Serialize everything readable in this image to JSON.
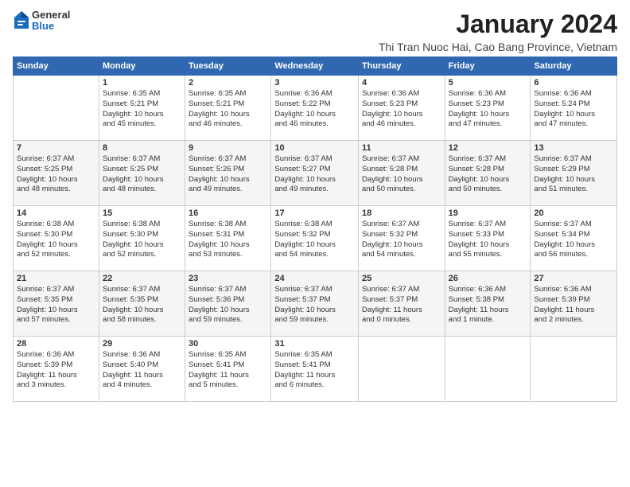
{
  "logo": {
    "general": "General",
    "blue": "Blue"
  },
  "title": "January 2024",
  "subtitle": "Thi Tran Nuoc Hai, Cao Bang Province, Vietnam",
  "calendar": {
    "headers": [
      "Sunday",
      "Monday",
      "Tuesday",
      "Wednesday",
      "Thursday",
      "Friday",
      "Saturday"
    ],
    "weeks": [
      [
        {
          "date": "",
          "text": ""
        },
        {
          "date": "1",
          "text": "Sunrise: 6:35 AM\nSunset: 5:21 PM\nDaylight: 10 hours\nand 45 minutes."
        },
        {
          "date": "2",
          "text": "Sunrise: 6:35 AM\nSunset: 5:21 PM\nDaylight: 10 hours\nand 46 minutes."
        },
        {
          "date": "3",
          "text": "Sunrise: 6:36 AM\nSunset: 5:22 PM\nDaylight: 10 hours\nand 46 minutes."
        },
        {
          "date": "4",
          "text": "Sunrise: 6:36 AM\nSunset: 5:23 PM\nDaylight: 10 hours\nand 46 minutes."
        },
        {
          "date": "5",
          "text": "Sunrise: 6:36 AM\nSunset: 5:23 PM\nDaylight: 10 hours\nand 47 minutes."
        },
        {
          "date": "6",
          "text": "Sunrise: 6:36 AM\nSunset: 5:24 PM\nDaylight: 10 hours\nand 47 minutes."
        }
      ],
      [
        {
          "date": "7",
          "text": "Sunrise: 6:37 AM\nSunset: 5:25 PM\nDaylight: 10 hours\nand 48 minutes."
        },
        {
          "date": "8",
          "text": "Sunrise: 6:37 AM\nSunset: 5:25 PM\nDaylight: 10 hours\nand 48 minutes."
        },
        {
          "date": "9",
          "text": "Sunrise: 6:37 AM\nSunset: 5:26 PM\nDaylight: 10 hours\nand 49 minutes."
        },
        {
          "date": "10",
          "text": "Sunrise: 6:37 AM\nSunset: 5:27 PM\nDaylight: 10 hours\nand 49 minutes."
        },
        {
          "date": "11",
          "text": "Sunrise: 6:37 AM\nSunset: 5:28 PM\nDaylight: 10 hours\nand 50 minutes."
        },
        {
          "date": "12",
          "text": "Sunrise: 6:37 AM\nSunset: 5:28 PM\nDaylight: 10 hours\nand 50 minutes."
        },
        {
          "date": "13",
          "text": "Sunrise: 6:37 AM\nSunset: 5:29 PM\nDaylight: 10 hours\nand 51 minutes."
        }
      ],
      [
        {
          "date": "14",
          "text": "Sunrise: 6:38 AM\nSunset: 5:30 PM\nDaylight: 10 hours\nand 52 minutes."
        },
        {
          "date": "15",
          "text": "Sunrise: 6:38 AM\nSunset: 5:30 PM\nDaylight: 10 hours\nand 52 minutes."
        },
        {
          "date": "16",
          "text": "Sunrise: 6:38 AM\nSunset: 5:31 PM\nDaylight: 10 hours\nand 53 minutes."
        },
        {
          "date": "17",
          "text": "Sunrise: 6:38 AM\nSunset: 5:32 PM\nDaylight: 10 hours\nand 54 minutes."
        },
        {
          "date": "18",
          "text": "Sunrise: 6:37 AM\nSunset: 5:32 PM\nDaylight: 10 hours\nand 54 minutes."
        },
        {
          "date": "19",
          "text": "Sunrise: 6:37 AM\nSunset: 5:33 PM\nDaylight: 10 hours\nand 55 minutes."
        },
        {
          "date": "20",
          "text": "Sunrise: 6:37 AM\nSunset: 5:34 PM\nDaylight: 10 hours\nand 56 minutes."
        }
      ],
      [
        {
          "date": "21",
          "text": "Sunrise: 6:37 AM\nSunset: 5:35 PM\nDaylight: 10 hours\nand 57 minutes."
        },
        {
          "date": "22",
          "text": "Sunrise: 6:37 AM\nSunset: 5:35 PM\nDaylight: 10 hours\nand 58 minutes."
        },
        {
          "date": "23",
          "text": "Sunrise: 6:37 AM\nSunset: 5:36 PM\nDaylight: 10 hours\nand 59 minutes."
        },
        {
          "date": "24",
          "text": "Sunrise: 6:37 AM\nSunset: 5:37 PM\nDaylight: 10 hours\nand 59 minutes."
        },
        {
          "date": "25",
          "text": "Sunrise: 6:37 AM\nSunset: 5:37 PM\nDaylight: 11 hours\nand 0 minutes."
        },
        {
          "date": "26",
          "text": "Sunrise: 6:36 AM\nSunset: 5:38 PM\nDaylight: 11 hours\nand 1 minute."
        },
        {
          "date": "27",
          "text": "Sunrise: 6:36 AM\nSunset: 5:39 PM\nDaylight: 11 hours\nand 2 minutes."
        }
      ],
      [
        {
          "date": "28",
          "text": "Sunrise: 6:36 AM\nSunset: 5:39 PM\nDaylight: 11 hours\nand 3 minutes."
        },
        {
          "date": "29",
          "text": "Sunrise: 6:36 AM\nSunset: 5:40 PM\nDaylight: 11 hours\nand 4 minutes."
        },
        {
          "date": "30",
          "text": "Sunrise: 6:35 AM\nSunset: 5:41 PM\nDaylight: 11 hours\nand 5 minutes."
        },
        {
          "date": "31",
          "text": "Sunrise: 6:35 AM\nSunset: 5:41 PM\nDaylight: 11 hours\nand 6 minutes."
        },
        {
          "date": "",
          "text": ""
        },
        {
          "date": "",
          "text": ""
        },
        {
          "date": "",
          "text": ""
        }
      ]
    ]
  }
}
